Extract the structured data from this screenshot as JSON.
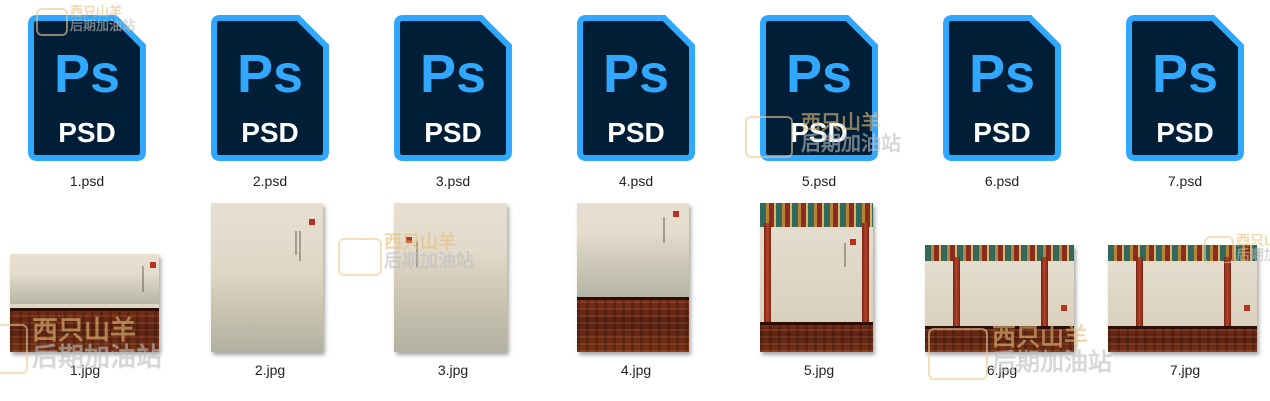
{
  "files": [
    {
      "name": "1.psd",
      "type": "psd",
      "badge_top": "Ps",
      "badge_bottom": "PSD"
    },
    {
      "name": "2.psd",
      "type": "psd",
      "badge_top": "Ps",
      "badge_bottom": "PSD"
    },
    {
      "name": "3.psd",
      "type": "psd",
      "badge_top": "Ps",
      "badge_bottom": "PSD"
    },
    {
      "name": "4.psd",
      "type": "psd",
      "badge_top": "Ps",
      "badge_bottom": "PSD"
    },
    {
      "name": "5.psd",
      "type": "psd",
      "badge_top": "Ps",
      "badge_bottom": "PSD"
    },
    {
      "name": "6.psd",
      "type": "psd",
      "badge_top": "Ps",
      "badge_bottom": "PSD"
    },
    {
      "name": "7.psd",
      "type": "psd",
      "badge_top": "Ps",
      "badge_bottom": "PSD"
    },
    {
      "name": "1.jpg",
      "type": "jpg"
    },
    {
      "name": "2.jpg",
      "type": "jpg"
    },
    {
      "name": "3.jpg",
      "type": "jpg"
    },
    {
      "name": "4.jpg",
      "type": "jpg"
    },
    {
      "name": "5.jpg",
      "type": "jpg"
    },
    {
      "name": "6.jpg",
      "type": "jpg"
    },
    {
      "name": "7.jpg",
      "type": "jpg"
    }
  ],
  "watermark": {
    "line1": "西只山羊",
    "line2": "后期加油站"
  },
  "colors": {
    "ps_fill": "#001e36",
    "ps_border": "#31a8ff",
    "ps_text": "#31a8ff",
    "psd_text": "#ffffff"
  }
}
